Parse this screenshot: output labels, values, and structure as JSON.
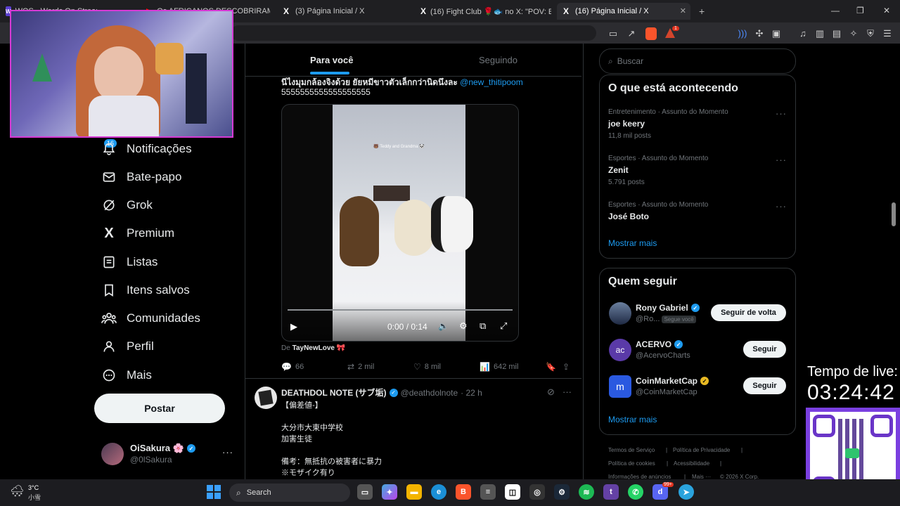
{
  "browser": {
    "tabs": [
      {
        "title": "WOS - Words On Stream"
      },
      {
        "title": "Os AFRICANOS DESCOBRIRAM A Am"
      },
      {
        "title": "(3) Página Inicial / X"
      },
      {
        "title": "(16) Fight Club 🌹🐟 no X: \"POV: Esp"
      },
      {
        "title": "(16) Página Inicial / X"
      }
    ],
    "new_tab": "+",
    "extension_badge": "1"
  },
  "nav": {
    "notifications_badge": "16",
    "items": [
      {
        "label": "Notificações",
        "icon": "bell-icon"
      },
      {
        "label": "Bate-papo",
        "icon": "mail-icon"
      },
      {
        "label": "Grok",
        "icon": "grok-icon"
      },
      {
        "label": "Premium",
        "icon": "x-logo-icon"
      },
      {
        "label": "Listas",
        "icon": "list-icon"
      },
      {
        "label": "Itens salvos",
        "icon": "bookmark-icon"
      },
      {
        "label": "Comunidades",
        "icon": "communities-icon"
      },
      {
        "label": "Perfil",
        "icon": "person-icon"
      },
      {
        "label": "Mais",
        "icon": "more-circle-icon"
      }
    ],
    "post_button": "Postar",
    "account": {
      "name": "OiSakura 🌸",
      "handle": "@0lSakura"
    }
  },
  "feed": {
    "tabs": [
      "Para você",
      "Seguindo"
    ],
    "post1": {
      "text": "นีไงมุมกล้องจิงด้วย ยัยหมีขาวตัวเล็กกว่านิดนึงละ",
      "mention": "@new_thitipoom",
      "text2": "5555555555555555555",
      "video_caption": "🐻 Teddy and Grandma 🐼",
      "video_time": "0:00 / 0:14",
      "video_progress": 0.0,
      "source_prefix": "De",
      "source": "TayNewLove 🎀",
      "replies": "66",
      "reposts": "2 mil",
      "likes": "8 mil",
      "views": "642 mil"
    },
    "post2": {
      "name": "DEATHDOL NOTE (サブ垢)",
      "handle": "@deathdolnote",
      "time": "· 22 h",
      "line1": "【偏差値-】",
      "line2": "大分市大東中学校",
      "line3": "加害生徒",
      "line4": "備考：無抵抗の被害者に暴力",
      "line5": "※モザイク有り"
    }
  },
  "sidebar": {
    "search_placeholder": "Buscar",
    "trends_title": "O que está acontecendo",
    "trends": [
      {
        "category": "Entretenimento · Assunto do Momento",
        "name": "joe keery",
        "posts": "11,8 mil posts"
      },
      {
        "category": "Esportes · Assunto do Momento",
        "name": "Zenit",
        "posts": "5.791 posts"
      },
      {
        "category": "Esportes · Assunto do Momento",
        "name": "José Boto",
        "posts": ""
      }
    ],
    "show_more": "Mostrar mais",
    "who_follow_title": "Quem seguir",
    "suggestions": [
      {
        "name": "Rony Gabriel",
        "handle": "@Ro...",
        "tag": "Segue você",
        "button": "Seguir de volta"
      },
      {
        "name": "ACERVO",
        "handle": "@AcervoCharts",
        "button": "Seguir"
      },
      {
        "name": "CoinMarketCap",
        "handle": "@CoinMarketCap",
        "button": "Seguir"
      }
    ],
    "show_more2": "Mostrar mais",
    "footer": [
      "Termos de Serviço",
      "|",
      "Política de Privacidade",
      "|",
      "Política de cookies",
      "|",
      "Acessibilidade",
      "|",
      "Informações de anúncios",
      "|",
      "Mais ···",
      "© 2026 X Corp."
    ]
  },
  "overlay": {
    "live_label": "Tempo de live:",
    "live_time": "03:24:42"
  },
  "taskbar": {
    "weather_temp": "3°C",
    "weather_desc": "小雪",
    "search_label": "Search",
    "discord_badge": "99+"
  }
}
